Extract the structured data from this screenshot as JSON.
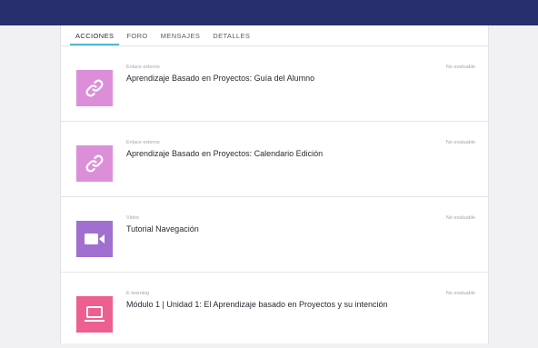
{
  "tabs": [
    {
      "label": "ACCIONES",
      "active": true
    },
    {
      "label": "FORO",
      "active": false
    },
    {
      "label": "MENSAJES",
      "active": false
    },
    {
      "label": "DETALLES",
      "active": false
    }
  ],
  "items": [
    {
      "type": "Enlace externo",
      "title": "Aprendizaje Basado en Proyectos: Guía del Alumno",
      "status": "No evaluable",
      "icon": "link-icon",
      "color": "#dc8fd8"
    },
    {
      "type": "Enlace externo",
      "title": "Aprendizaje Basado en Proyectos: Calendario Edición",
      "status": "No evaluable",
      "icon": "link-icon",
      "color": "#dc8fd8"
    },
    {
      "type": "Video",
      "title": "Tutorial Navegación",
      "status": "No evaluable",
      "icon": "video-camera-icon",
      "color": "#a06fd0"
    },
    {
      "type": "E-learning",
      "title": "Módulo 1 | Unidad 1: El Aprendizaje basado en Proyectos y su intención",
      "status": "No evaluable",
      "icon": "laptop-icon",
      "color": "#ee5f91"
    }
  ]
}
